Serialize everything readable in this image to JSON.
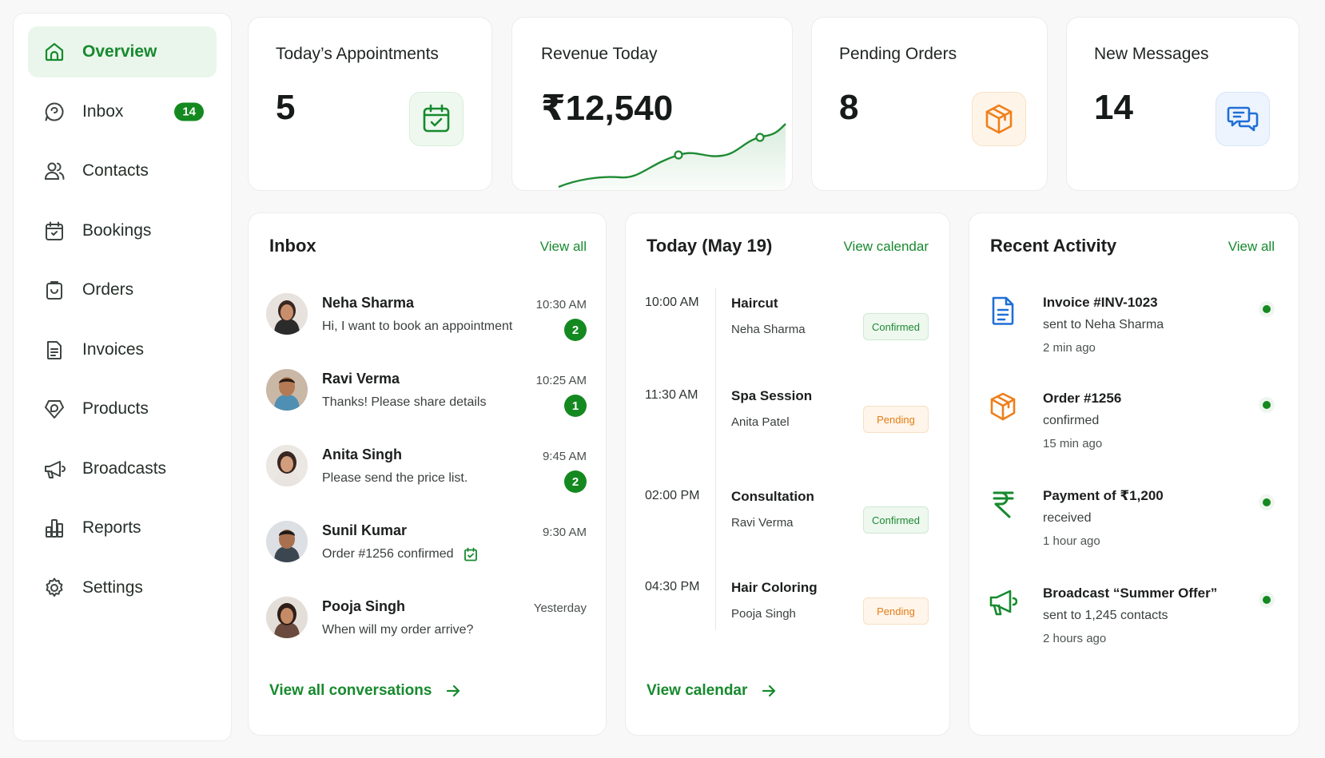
{
  "sidebar": {
    "items": [
      {
        "label": "Overview",
        "icon": "overview-icon",
        "active": true
      },
      {
        "label": "Inbox",
        "icon": "chat-icon",
        "badge": "14"
      },
      {
        "label": "Contacts",
        "icon": "contacts-icon"
      },
      {
        "label": "Bookings",
        "icon": "calendar-icon"
      },
      {
        "label": "Orders",
        "icon": "bag-icon"
      },
      {
        "label": "Invoices",
        "icon": "invoice-icon"
      },
      {
        "label": "Products",
        "icon": "product-icon"
      },
      {
        "label": "Broadcasts",
        "icon": "megaphone-icon"
      },
      {
        "label": "Reports",
        "icon": "reports-icon"
      },
      {
        "label": "Settings",
        "icon": "gear-icon"
      }
    ]
  },
  "stats": {
    "appointments": {
      "title": "Today’s Appointments",
      "value": "5",
      "icon": "calendar-check-icon"
    },
    "revenue": {
      "title": "Revenue Today",
      "value": "₹12,540",
      "icon": "sparkline-icon"
    },
    "orders": {
      "title": "Pending Orders",
      "value": "8",
      "icon": "box-icon"
    },
    "messages": {
      "title": "New Messages",
      "value": "14",
      "icon": "chat-bubbles-icon"
    }
  },
  "inbox": {
    "title": "Inbox",
    "view_all": "View all",
    "footer": "View all conversations",
    "messages": [
      {
        "name": "Neha Sharma",
        "preview": "Hi, I want to book an appointment",
        "time": "10:30 AM",
        "count": "2"
      },
      {
        "name": "Ravi Verma",
        "preview": "Thanks! Please share details",
        "time": "10:25 AM",
        "count": "1"
      },
      {
        "name": "Anita Singh",
        "preview": "Please send the price list.",
        "time": "9:45 AM",
        "count": "2"
      },
      {
        "name": "Sunil Kumar",
        "preview": "Order #1256 confirmed",
        "time": "9:30 AM",
        "count": ""
      },
      {
        "name": "Pooja Singh",
        "preview": "When will my order arrive?",
        "time": "Yesterday",
        "count": ""
      }
    ]
  },
  "schedule": {
    "title": "Today (May 19)",
    "view_calendar": "View calendar",
    "footer": "View calendar",
    "appointments": [
      {
        "time": "10:00 AM",
        "service": "Haircut",
        "client": "Neha Sharma",
        "status": "Confirmed"
      },
      {
        "time": "11:30 AM",
        "service": "Spa Session",
        "client": "Anita Patel",
        "status": "Pending"
      },
      {
        "time": "02:00 PM",
        "service": "Consultation",
        "client": "Ravi Verma",
        "status": "Confirmed"
      },
      {
        "time": "04:30 PM",
        "service": "Hair Coloring",
        "client": "Pooja Singh",
        "status": "Pending"
      }
    ]
  },
  "activity": {
    "title": "Recent Activity",
    "view_all": "View all",
    "items": [
      {
        "title": "Invoice #INV-1023",
        "sub": "sent to Neha Sharma",
        "ago": "2 min ago",
        "icon": "document-icon"
      },
      {
        "title": "Order #1256",
        "sub": "confirmed",
        "ago": "15 min ago",
        "icon": "box-icon"
      },
      {
        "title": "Payment of ₹1,200",
        "sub": "received",
        "ago": "1 hour ago",
        "icon": "rupee-icon"
      },
      {
        "title": "Broadcast “Summer Offer”",
        "sub": "sent to 1,245 contacts",
        "ago": "2 hours ago",
        "icon": "megaphone-icon"
      }
    ]
  },
  "colors": {
    "accent": "#178a2e",
    "orange": "#f0821e",
    "blue": "#1f7ae0"
  }
}
